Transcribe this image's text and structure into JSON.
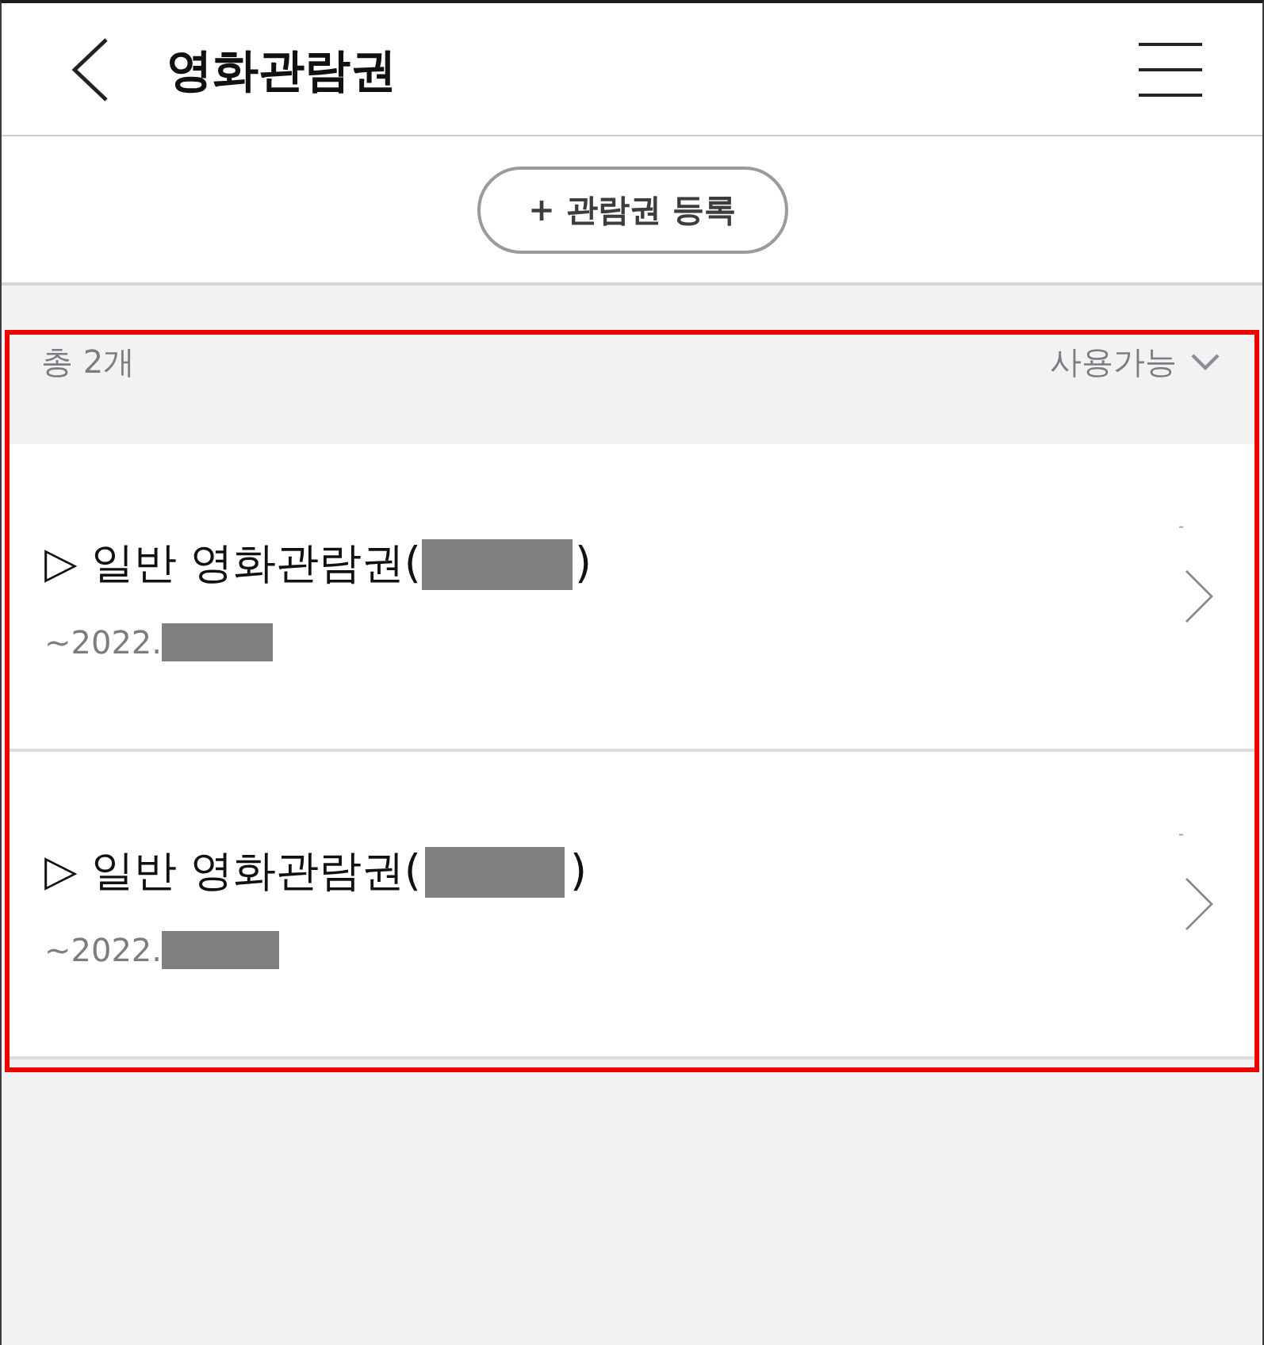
{
  "header": {
    "title": "영화관람권"
  },
  "register_button": {
    "label": "+ 관람권 등록"
  },
  "summary": {
    "count": "총 2개",
    "filter": "사용가능"
  },
  "tickets": [
    {
      "title": "▷ 일반 영화관람권(",
      "title_end": ")",
      "expiry": "~2022.",
      "note": "-"
    },
    {
      "title": "▷ 일반 영화관람권(",
      "title_end": ")",
      "expiry": "~2022.",
      "note": "-"
    }
  ]
}
